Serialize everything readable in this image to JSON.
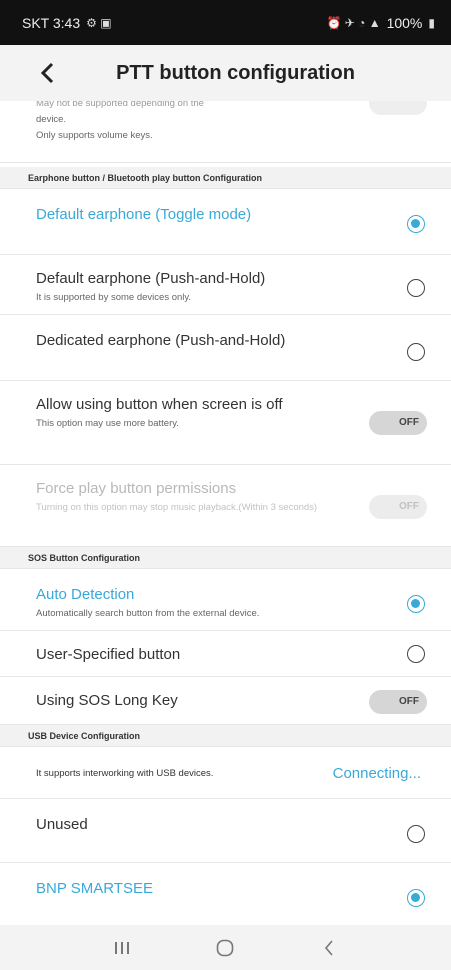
{
  "status": {
    "carrier_time": "SKT 3:43",
    "battery": "100%"
  },
  "appbar": {
    "title": "PTT button configuration"
  },
  "top_partial": {
    "cut_text": "May not be supported depending on the",
    "line2": "device.",
    "line3": "Only supports volume keys."
  },
  "sections": {
    "earphone": "Earphone button / Bluetooth play button Configuration",
    "sos": "SOS Button Configuration",
    "usb": "USB Device Configuration"
  },
  "earphone": {
    "default_toggle": "Default earphone (Toggle mode)",
    "default_push": "Default earphone (Push-and-Hold)",
    "default_push_sub": "It is supported by some devices only.",
    "dedicated_push": "Dedicated earphone (Push-and-Hold)",
    "screen_off": "Allow using button when screen is off",
    "screen_off_sub": "This option may use more battery.",
    "screen_off_toggle": "OFF",
    "force_play": "Force play button permissions",
    "force_play_sub": "Turning on this option may stop music playback.(Within 3 seconds)",
    "force_play_toggle": "OFF"
  },
  "sos": {
    "auto": "Auto Detection",
    "auto_sub": "Automatically search button from the external device.",
    "user": "User-Specified button",
    "long_key": "Using SOS Long Key",
    "long_key_toggle": "OFF"
  },
  "usb": {
    "info": "It supports interworking with USB devices.",
    "status": "Connecting...",
    "unused": "Unused",
    "bnp": "BNP SMARTSEE"
  },
  "icons": {
    "back": "chevron-left-icon",
    "nav_recent": "recent-apps-icon",
    "nav_home": "home-icon",
    "nav_back": "back-icon"
  },
  "colors": {
    "accent": "#38a9d9",
    "statusbar": "#111111"
  }
}
